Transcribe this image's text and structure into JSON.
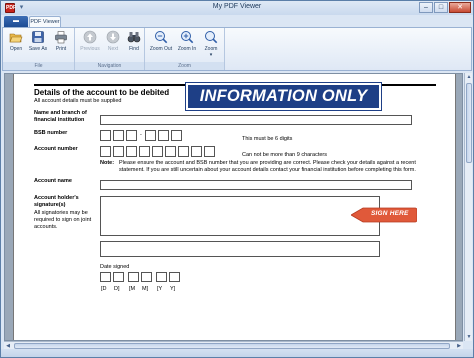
{
  "window": {
    "title": "My PDF Viewer",
    "app_icon_text": "PDF",
    "minimize": "–",
    "maximize": "□",
    "close": "✕"
  },
  "ribbon": {
    "app_menu_label": "",
    "tabs": [
      {
        "label": "PDF Viewer",
        "active": true
      }
    ],
    "groups": {
      "file": {
        "label": "File",
        "buttons": [
          {
            "label": "Open",
            "icon": "open-folder-icon",
            "enabled": true
          },
          {
            "label": "Save As",
            "icon": "save-disk-icon",
            "enabled": true
          },
          {
            "label": "Print",
            "icon": "printer-icon",
            "enabled": true
          }
        ]
      },
      "navigation": {
        "label": "Navigation",
        "buttons": [
          {
            "label": "Previous",
            "icon": "previous-arrow-icon",
            "enabled": false
          },
          {
            "label": "Next",
            "icon": "next-arrow-icon",
            "enabled": false
          },
          {
            "label": "Find",
            "icon": "binoculars-icon",
            "enabled": true
          }
        ]
      },
      "zoom": {
        "label": "Zoom",
        "buttons": [
          {
            "label": "Zoom Out",
            "icon": "zoom-out-icon",
            "enabled": true
          },
          {
            "label": "Zoom In",
            "icon": "zoom-in-icon",
            "enabled": true
          },
          {
            "label": "Zoom",
            "icon": "zoom-dropdown-icon",
            "enabled": true
          }
        ]
      }
    }
  },
  "document": {
    "section_title": "Details of the account to be debited",
    "section_subtitle": "All account details must be supplied",
    "banner": "INFORMATION ONLY",
    "labels": {
      "institution": "Name and branch of financial institution",
      "bsb": "BSB number",
      "account_number": "Account number",
      "account_name": "Account name",
      "signature": "Account holder's signature(s)",
      "signature_note": "All signatories may be required to sign on joint accounts.",
      "date_signed": "Date signed"
    },
    "bsb_hint": "This must be 6 digits",
    "bsb_separator": "-",
    "account_hint": "Can not be more than 9 characters",
    "note_label": "Note:",
    "note_text": "Please ensure the account and BSB number that you are providing are correct. Please check your details against a recent statement. If you are still uncertain about your account details contact your financial institution before completing this form.",
    "sign_here": "SIGN HERE",
    "date_letters": [
      "[D",
      "D]",
      "[M",
      "M]",
      "[Y",
      "Y]"
    ],
    "colors": {
      "banner": "#1e3f86",
      "sign_here": "#e0593a"
    }
  }
}
